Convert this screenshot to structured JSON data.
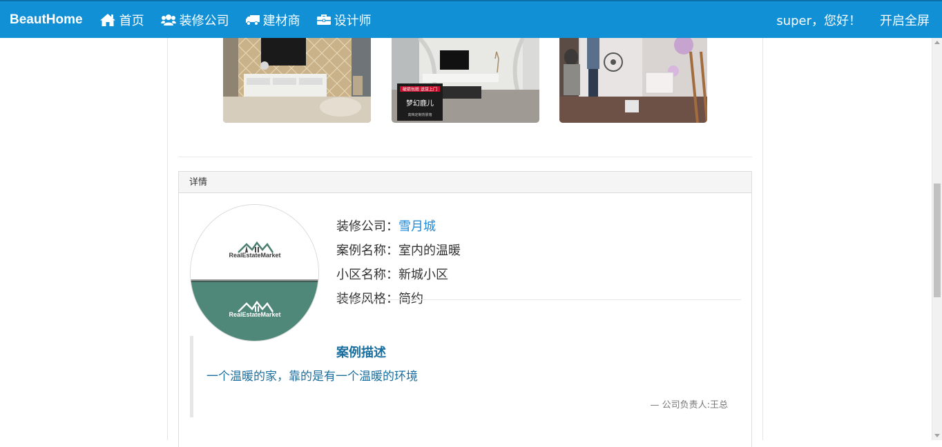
{
  "navbar": {
    "brand": "BeautHome",
    "items": [
      {
        "label": "首页",
        "icon": "home-icon"
      },
      {
        "label": "装修公司",
        "icon": "users-icon"
      },
      {
        "label": "建材商",
        "icon": "truck-icon"
      },
      {
        "label": "设计师",
        "icon": "briefcase-icon"
      }
    ],
    "greeting": "super，您好！",
    "fullscreen_label": "开启全屏",
    "bg_color": "#1190d6"
  },
  "photos": [
    {
      "name": "tv-wall-classic"
    },
    {
      "name": "tv-wall-deer",
      "caption_top": "破损包赔 送货上门",
      "caption_main": "梦幻鹿儿",
      "caption_sub": "高档定制背景墙"
    },
    {
      "name": "wall-installation"
    }
  ],
  "panel": {
    "heading": "详情",
    "logo_text_top": "RealEstateMarket",
    "logo_text_bottom": "RealEstateMarket",
    "fields": [
      {
        "label": "装修公司：",
        "value": "雪月城",
        "is_link": true
      },
      {
        "label": "案例名称：",
        "value": "室内的温暖",
        "is_link": false
      },
      {
        "label": "小区名称：",
        "value": "新城小区",
        "is_link": false
      },
      {
        "label": "装修风格：",
        "value": "简约",
        "is_link": false
      }
    ],
    "description_title": "案例描述",
    "description_text": "一个温暖的家，靠的是有一个温暖的环境",
    "quote_footer": "— 公司负责人:王总"
  }
}
